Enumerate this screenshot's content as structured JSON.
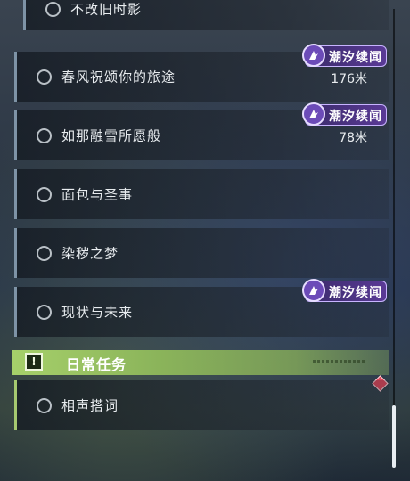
{
  "quests": [
    {
      "title": "不改旧时影"
    },
    {
      "title": "春风祝颂你的旅途",
      "badge": "潮汐续闻",
      "distance": "176米"
    },
    {
      "title": "如那融雪所愿般",
      "badge": "潮汐续闻",
      "distance": "78米"
    },
    {
      "title": "面包与圣事"
    },
    {
      "title": "染秽之梦"
    },
    {
      "title": "现状与未来",
      "badge": "潮汐续闻"
    }
  ],
  "daily_section": {
    "title": "日常任务",
    "icon_glyph": "!",
    "quests": [
      {
        "title": "相声搭词"
      }
    ]
  },
  "colors": {
    "badge_purple": "#5a3a96",
    "daily_green": "#a6d06a",
    "quest_bar": "#7e93a6",
    "marker_red": "#e0455a"
  },
  "icons": [
    "radio-circle-icon",
    "tide-badge-icon",
    "daily-alert-icon",
    "diamond-marker-icon"
  ]
}
